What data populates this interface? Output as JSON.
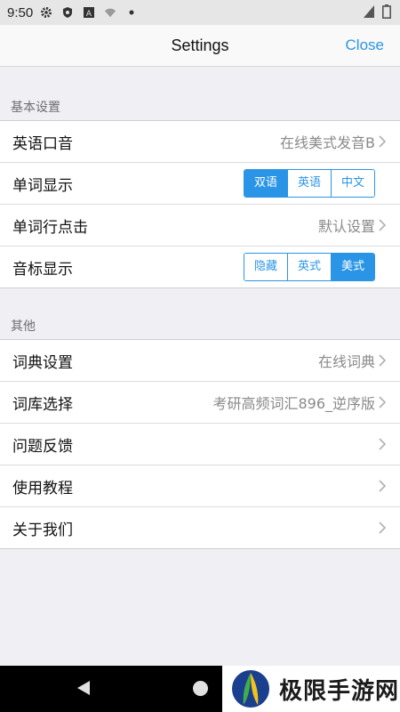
{
  "status_bar": {
    "time": "9:50",
    "icons": [
      "gear-icon",
      "shield-icon",
      "a-box-icon",
      "wifi-question-icon",
      "dot-icon"
    ],
    "right_icons": [
      "signal-icon",
      "battery-icon"
    ]
  },
  "nav": {
    "title": "Settings",
    "close_label": "Close"
  },
  "sections": {
    "basic": {
      "header": "基本设置",
      "rows": {
        "accent": {
          "label": "英语口音",
          "value": "在线美式发音B"
        },
        "word_display": {
          "label": "单词显示",
          "options": [
            "双语",
            "英语",
            "中文"
          ],
          "selected": "双语"
        },
        "row_click": {
          "label": "单词行点击",
          "value": "默认设置"
        },
        "phonetic": {
          "label": "音标显示",
          "options": [
            "隐藏",
            "英式",
            "美式"
          ],
          "selected": "美式"
        }
      }
    },
    "other": {
      "header": "其他",
      "rows": {
        "dictionary": {
          "label": "词典设置",
          "value": "在线词典"
        },
        "wordbank": {
          "label": "词库选择",
          "value": "考研高频词汇896_逆序版"
        },
        "feedback": {
          "label": "问题反馈"
        },
        "tutorial": {
          "label": "使用教程"
        },
        "about": {
          "label": "关于我们"
        }
      }
    }
  },
  "watermark": {
    "text": "极限手游网"
  },
  "colors": {
    "accent": "#2a95e6",
    "background": "#efeff4"
  }
}
